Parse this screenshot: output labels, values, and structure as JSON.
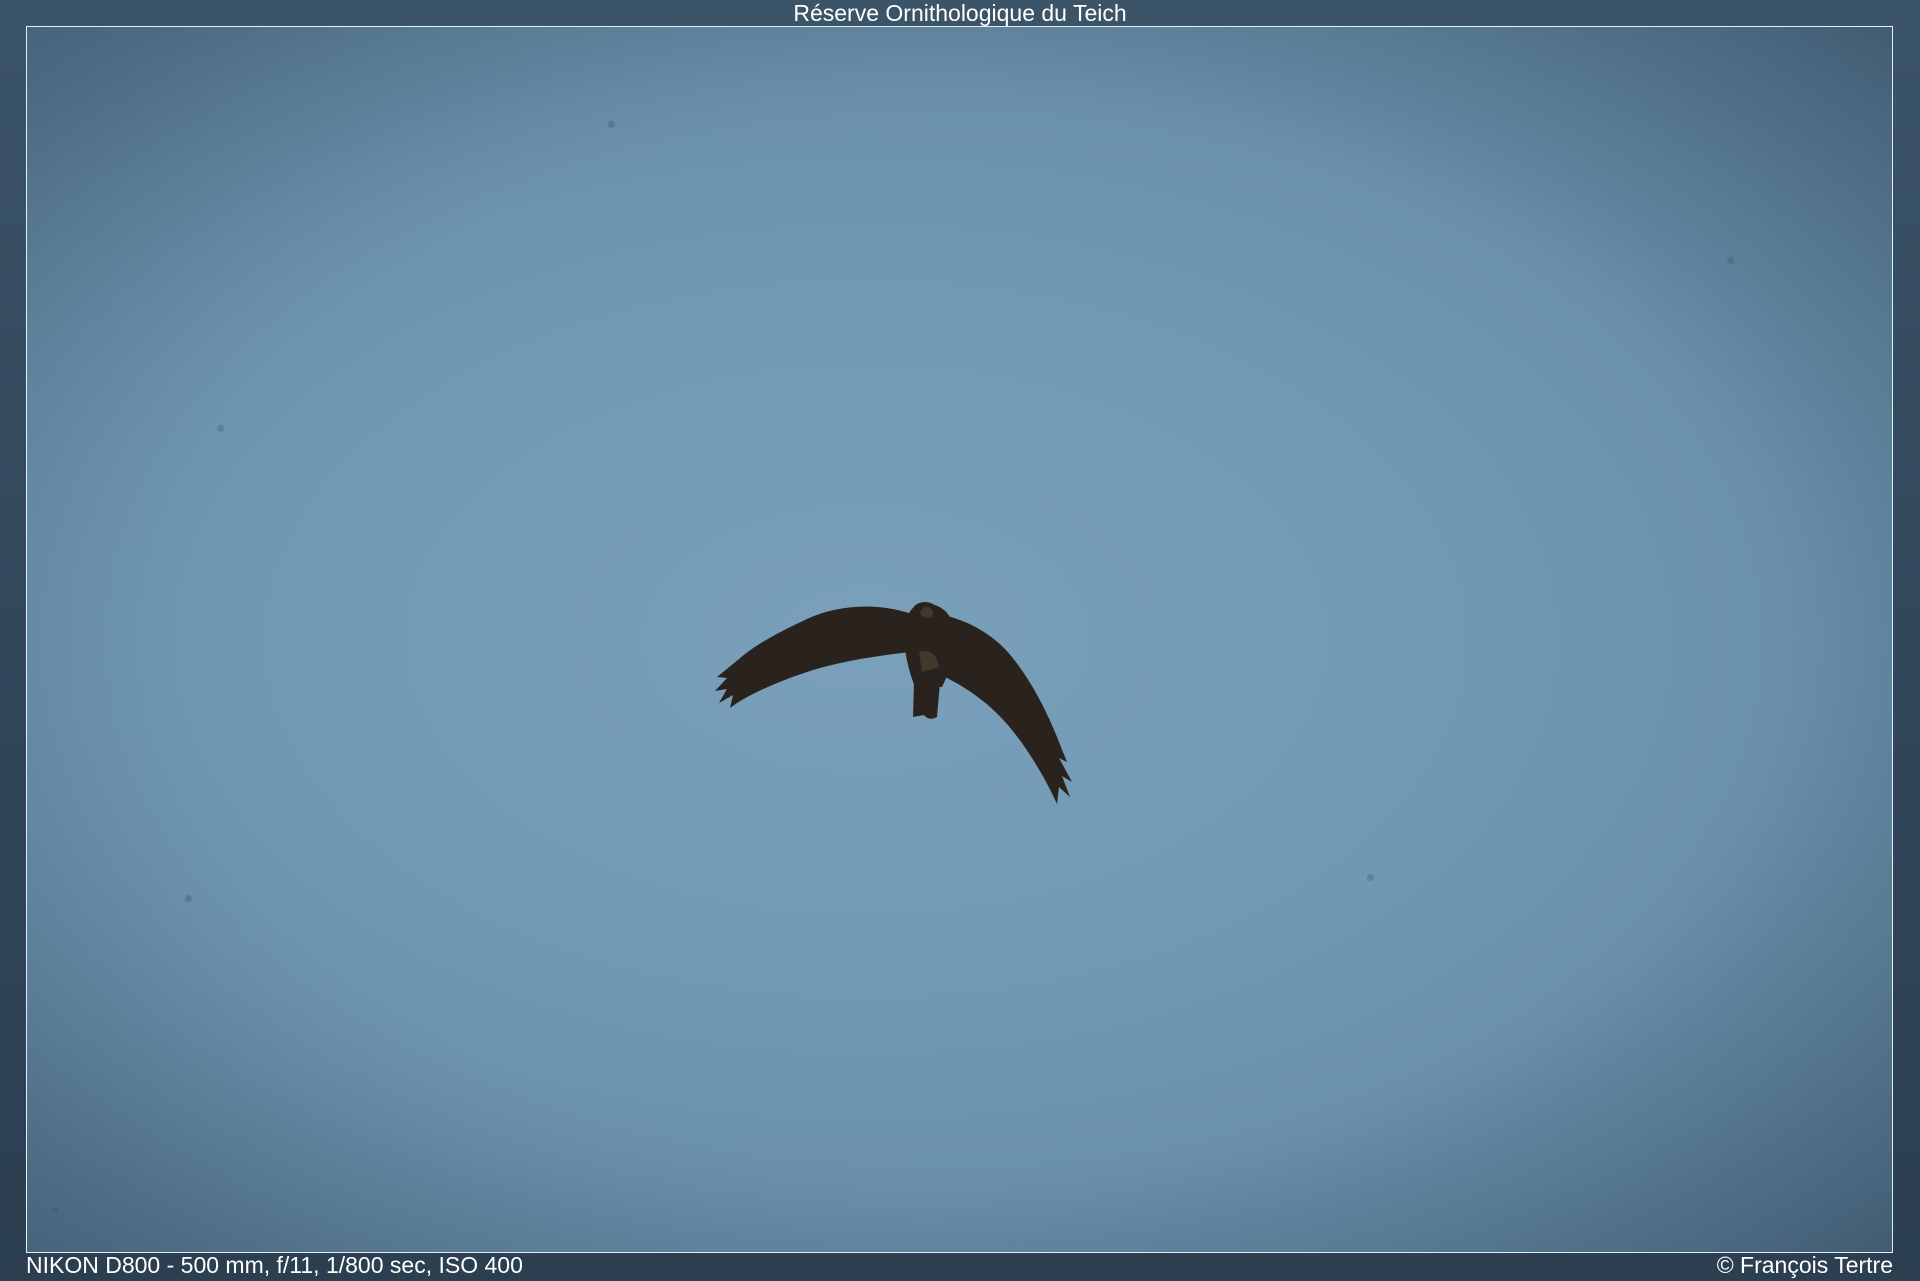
{
  "title": "Réserve Ornithologique du Teich",
  "exif": "NIKON D800 - 500 mm, f/11, 1/800 sec, ISO 400",
  "copyright": "© François Tertre",
  "colors": {
    "sky": "#7199b4",
    "bird": "#2a221c",
    "border": "#e6eef4"
  }
}
